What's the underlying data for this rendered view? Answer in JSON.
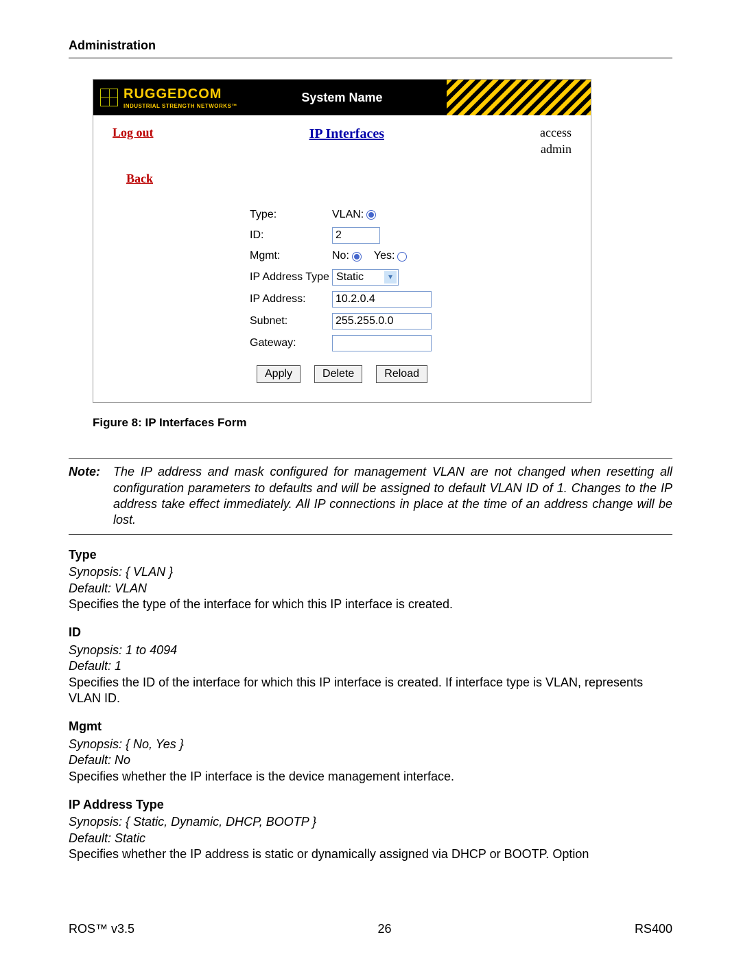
{
  "header": {
    "section": "Administration"
  },
  "screenshot": {
    "logo": {
      "name": "RUGGEDCOM",
      "tagline": "INDUSTRIAL STRENGTH NETWORKS™"
    },
    "title": "System Name",
    "logout": "Log out",
    "center_link": "IP Interfaces",
    "access_l1": "access",
    "access_l2": "admin",
    "back": "Back",
    "fields": {
      "type_label": "Type:",
      "type_option": "VLAN:",
      "id_label": "ID:",
      "id_value": "2",
      "mgmt_label": "Mgmt:",
      "mgmt_no": "No:",
      "mgmt_yes": "Yes:",
      "iptype_label": "IP Address Type",
      "iptype_value": "Static",
      "ipaddr_label": "IP Address:",
      "ipaddr_value": "10.2.0.4",
      "subnet_label": "Subnet:",
      "subnet_value": "255.255.0.0",
      "gateway_label": "Gateway:",
      "gateway_value": ""
    },
    "buttons": {
      "apply": "Apply",
      "delete": "Delete",
      "reload": "Reload"
    }
  },
  "figure_caption": "Figure 8: IP Interfaces Form",
  "note": {
    "label": "Note:",
    "text": "The IP address and mask configured for management VLAN are not changed when resetting all configuration parameters to defaults and will be assigned to default VLAN ID of 1. Changes to the IP address take effect immediately. All IP connections in place at the time of an address change will be lost."
  },
  "params": [
    {
      "title": "Type",
      "syn": "Synopsis: { VLAN }",
      "def": "Default: VLAN",
      "desc": "Specifies the type of the interface for which this IP interface is created."
    },
    {
      "title": "ID",
      "syn": "Synopsis: 1 to 4094",
      "def": "Default: 1",
      "desc": "Specifies the ID of the interface for which this IP interface is created. If interface type is VLAN, represents VLAN ID."
    },
    {
      "title": "Mgmt",
      "syn": "Synopsis: { No, Yes }",
      "def": "Default: No",
      "desc": "Specifies whether the IP interface is the device management interface."
    },
    {
      "title": "IP Address Type",
      "syn": "Synopsis: { Static, Dynamic, DHCP, BOOTP }",
      "def": "Default: Static",
      "desc": "Specifies whether the IP address is static or dynamically assigned via DHCP or BOOTP. Option"
    }
  ],
  "footer": {
    "left": "ROS™  v3.5",
    "center": "26",
    "right": "RS400"
  }
}
